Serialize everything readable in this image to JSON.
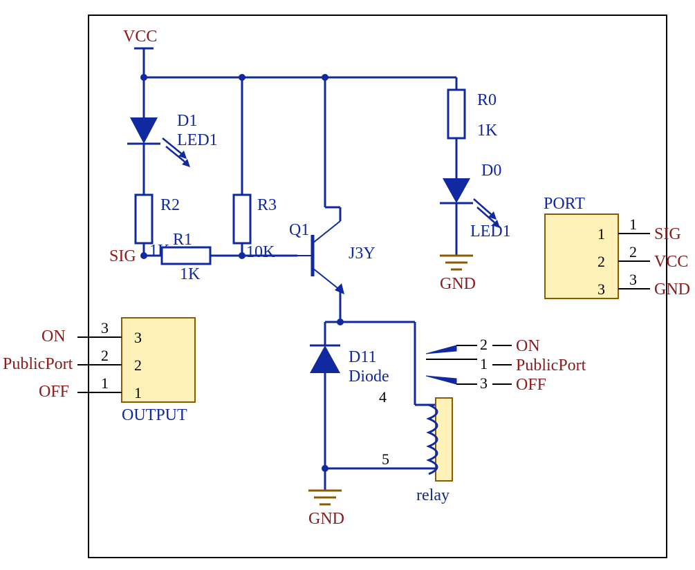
{
  "power": {
    "vcc": "VCC",
    "gnd_d0": "GND",
    "gnd_main": "GND"
  },
  "components": {
    "r0": {
      "ref": "R0",
      "value": "1K"
    },
    "r1": {
      "ref": "R1",
      "value": "1K"
    },
    "r2": {
      "ref": "R2",
      "value": "1K"
    },
    "r3": {
      "ref": "R3",
      "value": "10K"
    },
    "d0": {
      "ref": "D0",
      "type": "LED1"
    },
    "d1": {
      "ref": "D1",
      "type": "LED1"
    },
    "d11": {
      "ref": "D11",
      "type": "Diode"
    },
    "q1": {
      "ref": "Q1",
      "part": "J3Y"
    },
    "relay": {
      "name": "relay"
    }
  },
  "connectors": {
    "output": {
      "name": "OUTPUT",
      "pins": [
        {
          "num": "3",
          "label": "ON"
        },
        {
          "num": "2",
          "label": "PublicPort"
        },
        {
          "num": "1",
          "label": "OFF"
        }
      ]
    },
    "port": {
      "name": "PORT",
      "pins": [
        {
          "num": "1",
          "label": "SIG"
        },
        {
          "num": "2",
          "label": "VCC"
        },
        {
          "num": "3",
          "label": "GND"
        }
      ]
    }
  },
  "nets": {
    "sig_left": "SIG",
    "relay_pins": {
      "on": {
        "num": "2",
        "label": "ON"
      },
      "public": {
        "num": "1",
        "label": "PublicPort"
      },
      "off": {
        "num": "3",
        "label": "OFF"
      },
      "coil_a": "4",
      "coil_b": "5"
    }
  }
}
